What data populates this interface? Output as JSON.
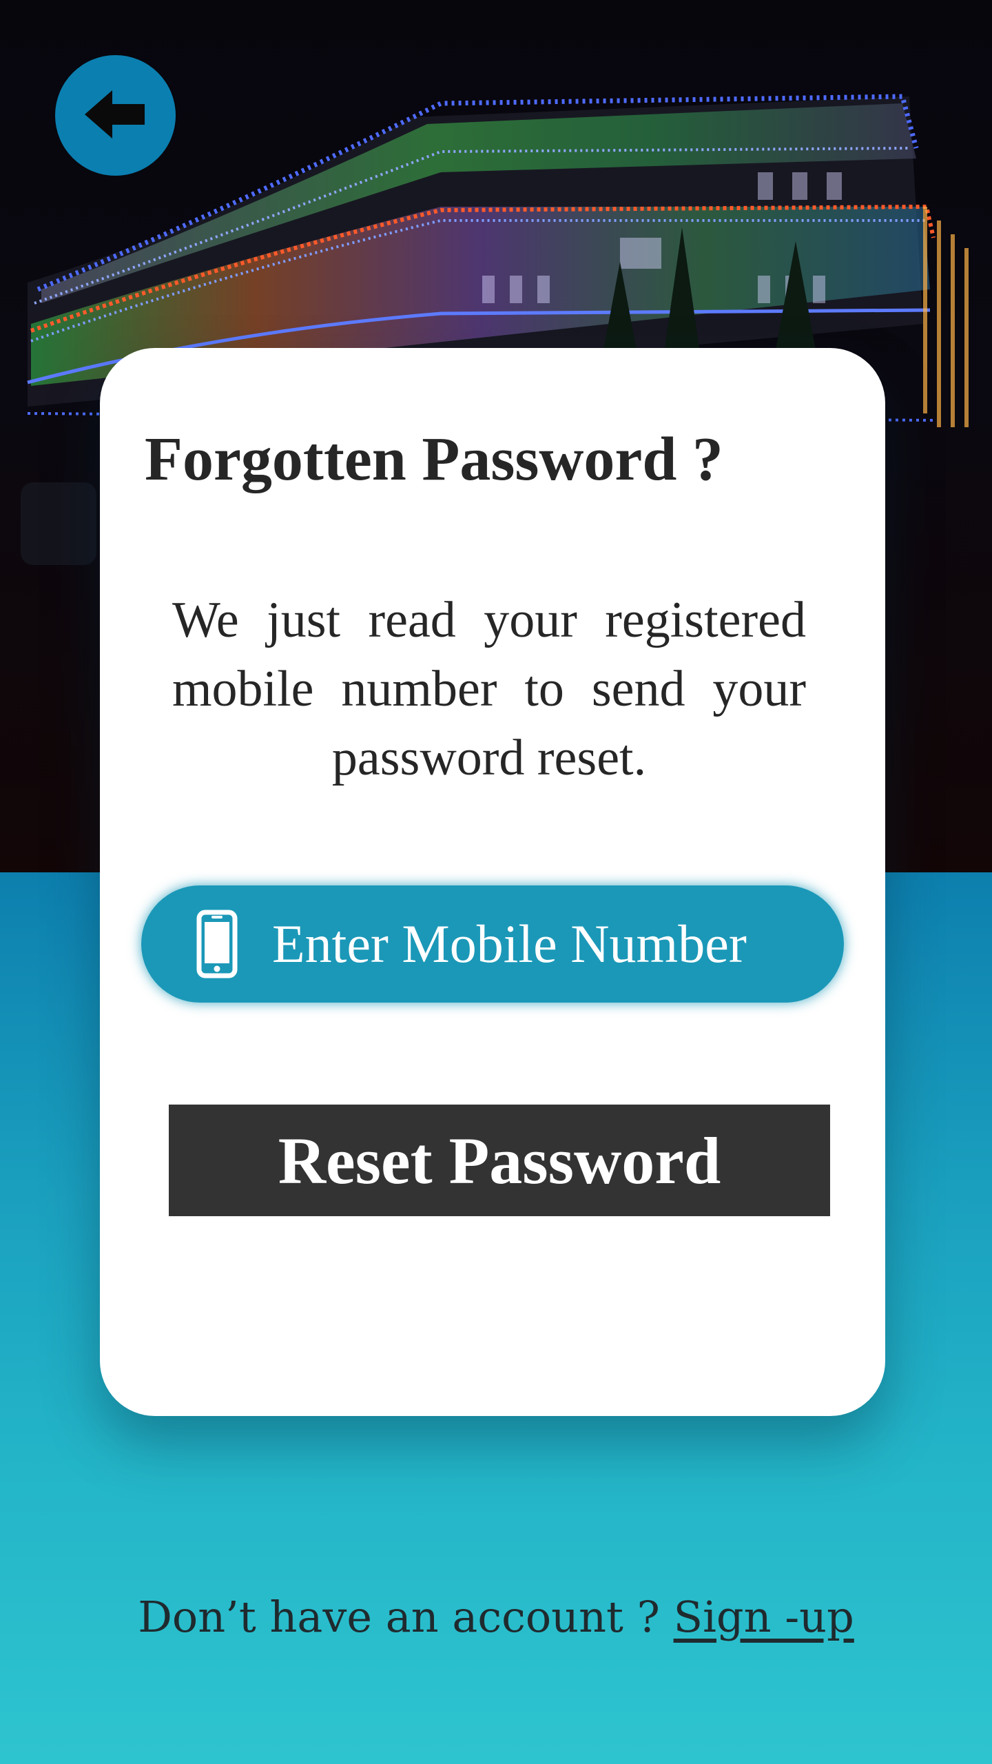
{
  "header": {
    "back_icon": "arrow-left-icon"
  },
  "hero": {
    "image_description": "illuminated-building-at-night"
  },
  "card": {
    "title": "Forgotten Password ?",
    "description": "We just read your registered mobile number to send your password reset.",
    "mobile_field": {
      "icon": "mobile-phone-icon",
      "placeholder": "Enter Mobile Number",
      "value": ""
    },
    "reset_button_label": "Reset Password"
  },
  "footer": {
    "prompt": "Don’t have an account ? ",
    "signup_link": "Sign -up"
  },
  "colors": {
    "accent": "#0b7fb0",
    "input_bg": "#1b98b8",
    "button_bg": "#333333",
    "gradient_top": "#0d7fae",
    "gradient_bottom": "#2ec4cf"
  }
}
